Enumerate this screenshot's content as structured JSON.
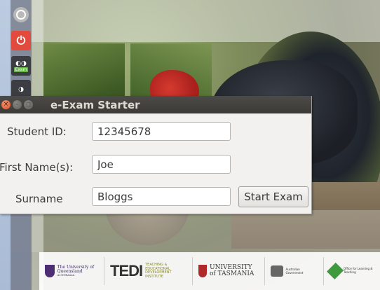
{
  "window": {
    "title": "e-Exam Starter",
    "close_glyph": "×",
    "minimize_glyph": "–",
    "maximize_glyph": "□"
  },
  "form": {
    "student_id_label": "Student ID:",
    "student_id_value": "12345678",
    "first_name_label": "First Name(s):",
    "first_name_value": "Joe",
    "surname_label": "Surname",
    "surname_value": "Bloggs",
    "start_button_label": "Start Exam"
  },
  "launcher": {
    "items": [
      {
        "icon": "ubuntu-home-icon"
      },
      {
        "icon": "power-icon",
        "glyph": "⏻"
      },
      {
        "icon": "exam-app-icon",
        "label": "Exam"
      },
      {
        "icon": "exam-app-icon-2"
      }
    ]
  },
  "logos": {
    "uq": "The University of Queensland",
    "uq_sub": "AUSTRALIA",
    "tedi": "TEDI",
    "tedi_sub": "TEACHING & EDUCATIONAL DEVELOPMENT INSTITUTE",
    "utas": "UNIVERSITY of TASMANIA",
    "gov": "Australian Government",
    "olt": "Office for Learning & Teaching"
  },
  "colors": {
    "titlebar": "#3b3a37",
    "close_button": "#e0502a",
    "window_bg": "#f2f1f0"
  }
}
